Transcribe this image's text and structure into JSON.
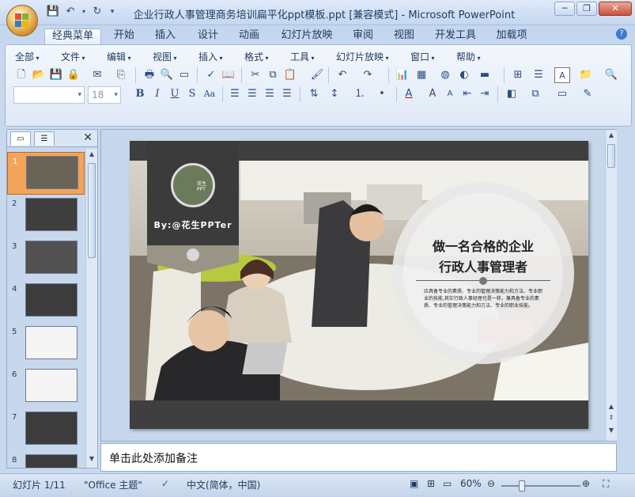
{
  "window": {
    "title": "企业行政人事管理商务培训扁平化ppt模板.ppt [兼容模式] - Microsoft PowerPoint"
  },
  "ribbon_tabs": [
    "经典菜单",
    "开始",
    "插入",
    "设计",
    "动画",
    "幻灯片放映",
    "审阅",
    "视图",
    "开发工具",
    "加载项"
  ],
  "classic_menu": [
    "全部",
    "文件",
    "编辑",
    "视图",
    "插入",
    "格式",
    "工具",
    "幻灯片放映",
    "窗口",
    "帮助"
  ],
  "font_combo": {
    "font": "",
    "size": "18"
  },
  "thumbnails": {
    "numbers": [
      "1",
      "2",
      "3",
      "4",
      "5",
      "6",
      "7",
      "8"
    ],
    "selected": 1
  },
  "slide": {
    "author": "By:@花生PPTer",
    "badge_text": "花生PPT",
    "heading_line1": "做一名合格的企业",
    "heading_line2": "行政人事管理者",
    "body": "应具备专业的素质、专业的管理决策能力和方法、专业职业的技能,其实行政人事经理也是一样，兼具备专业的素质、专业的管理决策能力和方法、专业的职业技能。"
  },
  "notes_placeholder": "单击此处添加备注",
  "status": {
    "slide_info": "幻灯片 1/11",
    "theme": "\"Office 主题\"",
    "language": "中文(简体，中国)",
    "zoom": "60%"
  },
  "colors": {
    "accent": "#f2a45a",
    "ribbon_bg": "#dfe9f6",
    "slide_dark": "#3f3f3f"
  }
}
